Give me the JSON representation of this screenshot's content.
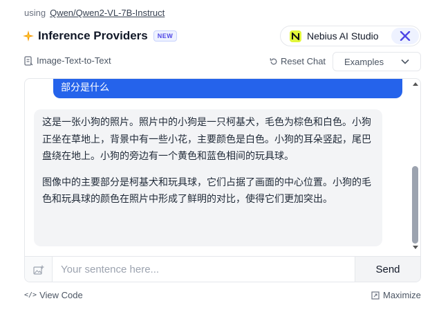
{
  "header": {
    "using_label": "using",
    "model_name": "Qwen/Qwen2-VL-7B-Instruct"
  },
  "providers": {
    "title": "Inference Providers",
    "badge": "NEW",
    "selected_provider": "Nebius AI Studio",
    "provider_icon": "nebius-logo-icon",
    "hf_icon": "huggingface-icon"
  },
  "toolbar": {
    "task_label": "Image-Text-to-Text",
    "reset_label": "Reset Chat",
    "examples_label": "Examples"
  },
  "chat": {
    "user_message": "部分是什么",
    "assistant_paragraphs": [
      "这是一张小狗的照片。照片中的小狗是一只柯基犬，毛色为棕色和白色。小狗正坐在草地上，背景中有一些小花，主要颜色是白色。小狗的耳朵竖起，尾巴盘绕在地上。小狗的旁边有一个黄色和蓝色相间的玩具球。",
      "图像中的主要部分是柯基犬和玩具球，它们占据了画面的中心位置。小狗的毛色和玩具球的颜色在照片中形成了鲜明的对比，使得它们更加突出。"
    ]
  },
  "input": {
    "placeholder": "Your sentence here...",
    "value": "",
    "send_label": "Send"
  },
  "footer": {
    "view_code_label": "View Code",
    "maximize_label": "Maximize"
  },
  "colors": {
    "user_bubble": "#2563eb",
    "assistant_bubble": "#f3f4f6",
    "badge_text": "#4f46e5",
    "nebius_accent": "#e2f63a"
  }
}
